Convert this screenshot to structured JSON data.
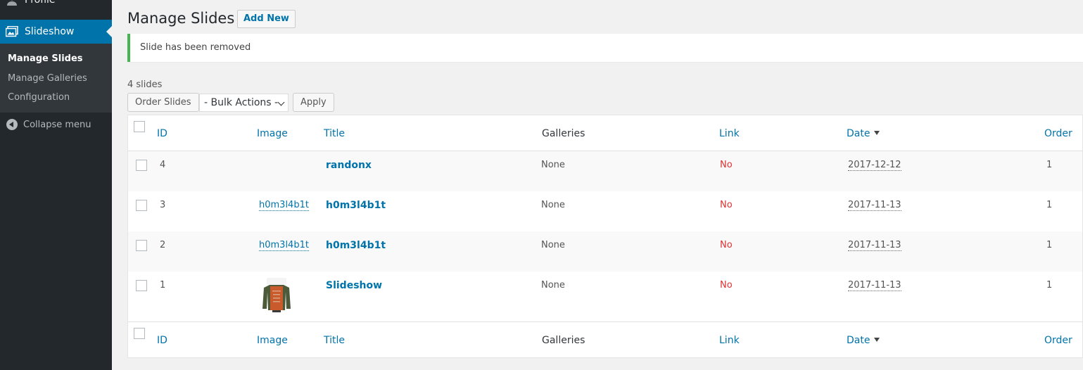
{
  "sidebar": {
    "profile_label": "Profile",
    "active_label": "Slideshow",
    "submenu": [
      "Manage Slides",
      "Manage Galleries",
      "Configuration"
    ],
    "collapse_label": "Collapse menu"
  },
  "header": {
    "title": "Manage Slides",
    "add_new": "Add New"
  },
  "notice": "Slide has been removed",
  "toolbar": {
    "count": "4 slides",
    "order_slides": "Order Slides",
    "bulk_actions": "- Bulk Actions -",
    "apply": "Apply"
  },
  "columns": {
    "id": "ID",
    "image": "Image",
    "title": "Title",
    "galleries": "Galleries",
    "link": "Link",
    "date": "Date",
    "order": "Order"
  },
  "rows": [
    {
      "id": "4",
      "image": "",
      "title": "randonx",
      "galleries": "None",
      "link": "No",
      "date": "2017-12-12",
      "order": "1"
    },
    {
      "id": "3",
      "image": "h0m3l4b1t",
      "title": "h0m3l4b1t",
      "galleries": "None",
      "link": "No",
      "date": "2017-11-13",
      "order": "1"
    },
    {
      "id": "2",
      "image": "h0m3l4b1t",
      "title": "h0m3l4b1t",
      "galleries": "None",
      "link": "No",
      "date": "2017-11-13",
      "order": "1"
    },
    {
      "id": "1",
      "image": "thumbnail",
      "title": "Slideshow",
      "galleries": "None",
      "link": "No",
      "date": "2017-11-13",
      "order": "1"
    }
  ],
  "colors": {
    "accent": "#0073aa",
    "sidebar_bg": "#23282d",
    "notice_border": "#46b450",
    "no_link": "#dc3232"
  },
  "icons": [
    "user-icon",
    "slideshow-icon",
    "collapse-icon",
    "sort-desc-icon",
    "dropdown-chevron-icon"
  ]
}
